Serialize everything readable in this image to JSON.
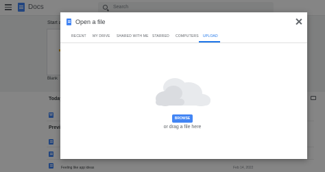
{
  "app": {
    "title": "Docs"
  },
  "search": {
    "placeholder": "Search"
  },
  "background": {
    "start_label": "Start a",
    "blank_label": "Blank",
    "today_label": "Today",
    "previous_label": "Previo",
    "bottom_row": {
      "title": "Feeling like app ideas",
      "date": "Feb 14, 2022"
    }
  },
  "dialog": {
    "title": "Open a file",
    "tabs": [
      {
        "label": "RECENT"
      },
      {
        "label": "MY DRIVE"
      },
      {
        "label": "SHARED WITH ME"
      },
      {
        "label": "STARRED"
      },
      {
        "label": "COMPUTERS"
      },
      {
        "label": "UPLOAD"
      }
    ],
    "active_tab": "UPLOAD",
    "browse_label": "BROWSE",
    "drag_text": "or drag a file here"
  },
  "colors": {
    "accent": "#1a73e8",
    "button": "#4285f4",
    "scrim": "rgba(0,0,0,0.48)"
  }
}
